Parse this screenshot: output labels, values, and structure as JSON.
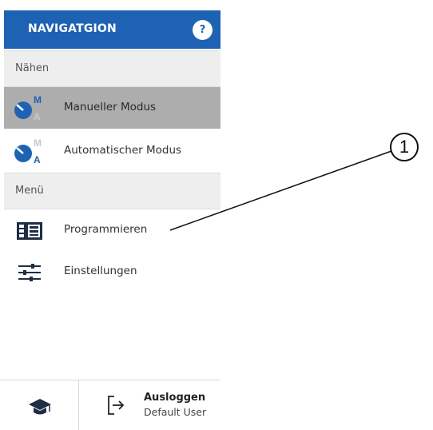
{
  "header": {
    "title": "NAVIGATGION",
    "help_label": "?"
  },
  "sections": [
    {
      "label": "Nähen"
    },
    {
      "label": "Menü"
    }
  ],
  "nav_items": [
    {
      "label": "Manueller Modus",
      "active": true,
      "icon": "manual-mode-icon"
    },
    {
      "label": "Automatischer Modus",
      "active": false,
      "icon": "automatic-mode-icon"
    },
    {
      "label": "Programmieren",
      "active": false,
      "icon": "program-icon"
    },
    {
      "label": "Einstellungen",
      "active": false,
      "icon": "settings-sliders-icon"
    }
  ],
  "mode_letters": {
    "manual": "M",
    "automatic": "A"
  },
  "footer": {
    "help_icon": "graduation-cap-icon",
    "logout_label": "Ausloggen",
    "user": "Default User",
    "logout_icon": "logout-icon"
  },
  "callout": {
    "number": "1"
  },
  "colors": {
    "header": "#1e63b3",
    "active_item": "#adadad",
    "section_bg": "#eeeeee",
    "icon_blue": "#1e63b3"
  }
}
